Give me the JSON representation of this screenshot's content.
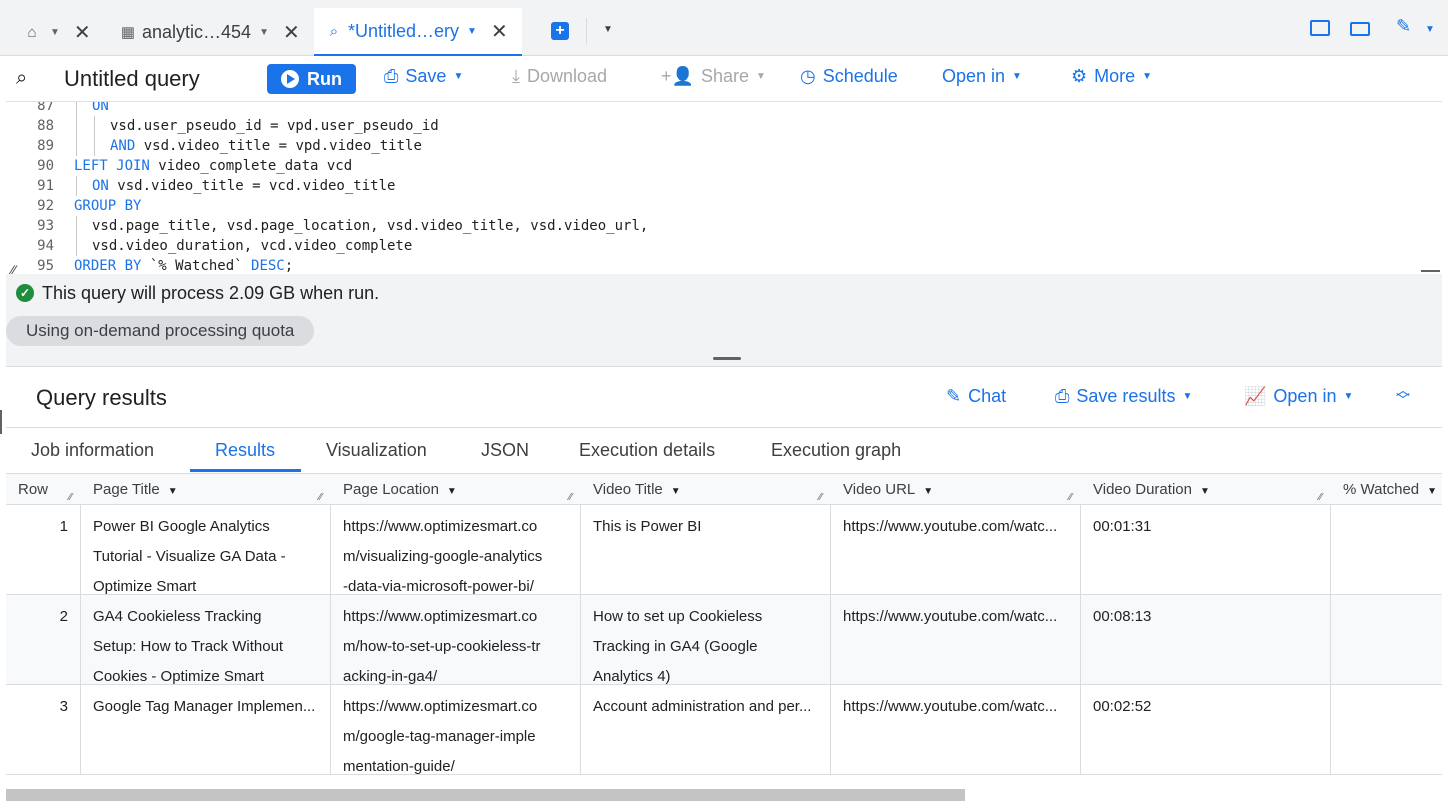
{
  "tabs": [
    {
      "label": "",
      "icon": "home-icon"
    },
    {
      "label": "analytic…454",
      "icon": "table-icon"
    },
    {
      "label": "*Untitled…ery",
      "icon": "query-icon",
      "active": true
    }
  ],
  "toolbar": {
    "title": "Untitled query",
    "run": "Run",
    "save": "Save",
    "download": "Download",
    "share": "Share",
    "schedule": "Schedule",
    "open_in": "Open in",
    "more": "More"
  },
  "editor": {
    "lines": [
      {
        "num": "87",
        "indent": 1,
        "parts": [
          {
            "t": "ON",
            "kw": true
          }
        ]
      },
      {
        "num": "88",
        "indent": 2,
        "parts": [
          {
            "t": "vsd.user_pseudo_id = vpd.user_pseudo_id"
          }
        ]
      },
      {
        "num": "89",
        "indent": 2,
        "parts": [
          {
            "t": "AND",
            "kw": true
          },
          {
            "t": " vsd.video_title = vpd.video_title"
          }
        ]
      },
      {
        "num": "90",
        "indent": 0,
        "parts": [
          {
            "t": "LEFT JOIN",
            "kw": true
          },
          {
            "t": " video_complete_data vcd"
          }
        ]
      },
      {
        "num": "91",
        "indent": 1,
        "parts": [
          {
            "t": "ON",
            "kw": true
          },
          {
            "t": " vsd.video_title = vcd.video_title"
          }
        ]
      },
      {
        "num": "92",
        "indent": 0,
        "parts": [
          {
            "t": "GROUP BY",
            "kw": true
          }
        ]
      },
      {
        "num": "93",
        "indent": 1,
        "parts": [
          {
            "t": "vsd.page_title, vsd.page_location, vsd.video_title, vsd.video_url,"
          }
        ]
      },
      {
        "num": "94",
        "indent": 1,
        "parts": [
          {
            "t": "vsd.video_duration, vcd.video_complete"
          }
        ]
      },
      {
        "num": "95",
        "indent": 0,
        "parts": [
          {
            "t": "ORDER BY",
            "kw": true
          },
          {
            "t": " `% Watched` "
          },
          {
            "t": "DESC",
            "kw": true
          },
          {
            "t": ";"
          }
        ]
      }
    ]
  },
  "validation": {
    "message": "This query will process 2.09 GB when run.",
    "quota": "Using on-demand processing quota"
  },
  "results": {
    "title": "Query results",
    "chat": "Chat",
    "save_results": "Save results",
    "open_in": "Open in",
    "tabs": [
      "Job information",
      "Results",
      "Visualization",
      "JSON",
      "Execution details",
      "Execution graph"
    ],
    "active_tab": "Results",
    "columns": [
      "Row",
      "Page Title",
      "Page Location",
      "Video Title",
      "Video URL",
      "Video Duration",
      "% Watched"
    ],
    "rows": [
      {
        "row": "1",
        "page_title": "Power BI Google Analytics\nTutorial - Visualize GA Data -\nOptimize Smart",
        "page_location": "https://www.optimizesmart.co\nm/visualizing-google-analytics\n-data-via-microsoft-power-bi/",
        "video_title": "This is Power BI",
        "video_url": "https://www.youtube.com/watc...",
        "video_duration": "00:01:31",
        "watched": ""
      },
      {
        "row": "2",
        "page_title": "GA4 Cookieless Tracking\nSetup: How to Track Without\nCookies - Optimize Smart",
        "page_location": "https://www.optimizesmart.co\nm/how-to-set-up-cookieless-tr\nacking-in-ga4/",
        "video_title": "How to set up Cookieless\nTracking in GA4 (Google\nAnalytics 4)",
        "video_url": "https://www.youtube.com/watc...",
        "video_duration": "00:08:13",
        "watched": ""
      },
      {
        "row": "3",
        "page_title": "Google Tag Manager Implemen...",
        "page_location": "https://www.optimizesmart.co\nm/google-tag-manager-imple\nmentation-guide/",
        "video_title": "Account administration and per...",
        "video_url": "https://www.youtube.com/watc...",
        "video_duration": "00:02:52",
        "watched": ""
      }
    ]
  },
  "colors": {
    "accent": "#1a73e8",
    "success": "#1e8e3e"
  }
}
